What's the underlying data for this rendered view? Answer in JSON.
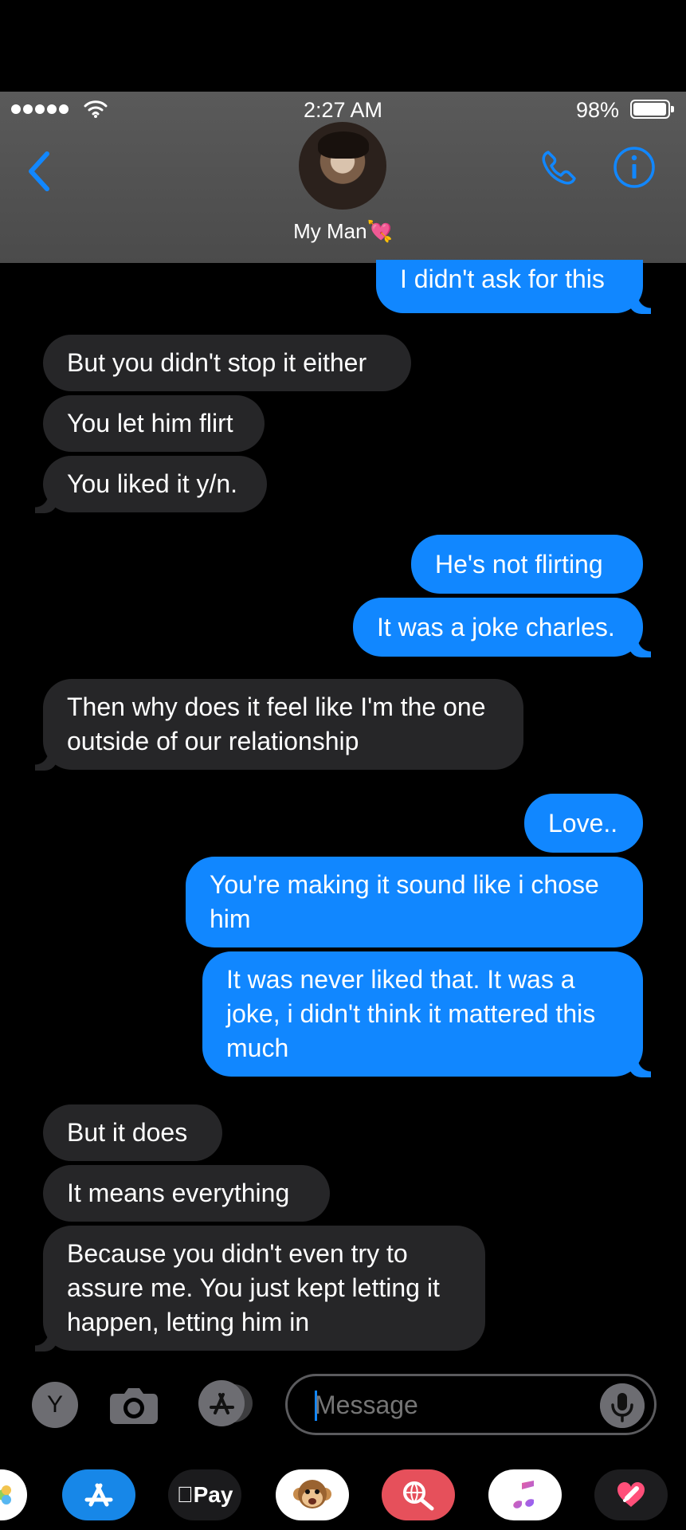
{
  "status_bar": {
    "time": "2:27 AM",
    "battery_percent": "98%",
    "signal_dots": 5,
    "battery_level": 0.98
  },
  "header": {
    "contact_name": "My Man💘",
    "icons": {
      "back": "chevron-left-icon",
      "phone": "phone-icon",
      "info": "info-icon",
      "avatar": "avatar"
    },
    "accent_color": "#1187ff"
  },
  "messages": [
    {
      "text": "I didn't ask for this",
      "sender": "me"
    },
    {
      "text": "But you didn't stop it either",
      "sender": "contact"
    },
    {
      "text": "You let him flirt",
      "sender": "contact"
    },
    {
      "text": "You liked it y/n.",
      "sender": "contact"
    },
    {
      "text": "He's not flirting",
      "sender": "me"
    },
    {
      "text": "It was a joke charles.",
      "sender": "me"
    },
    {
      "text": "Then why does it feel like I'm the one outside of our relationship",
      "sender": "contact"
    },
    {
      "text": "Love..",
      "sender": "me"
    },
    {
      "text": "You're making it sound like i chose him",
      "sender": "me"
    },
    {
      "text": "It was never liked that. It was a joke, i didn't think it mattered this much",
      "sender": "me"
    },
    {
      "text": "But it does",
      "sender": "contact"
    },
    {
      "text": "It means everything",
      "sender": "contact"
    },
    {
      "text": "Because you didn't even try to assure me. You just kept letting it happen, letting him in",
      "sender": "contact"
    }
  ],
  "composer": {
    "left_button_label": "Y",
    "message_placeholder": "Message",
    "icons": {
      "camera": "camera-icon",
      "app_store": "app-store-icon",
      "microphone": "microphone-icon"
    }
  },
  "dock": {
    "apple_pay_label": "Pay",
    "icons": [
      "photos-icon",
      "app-store-icon",
      "apple-pay-icon",
      "animoji-icon",
      "images-search-icon",
      "music-icon",
      "digital-touch-icon"
    ]
  }
}
